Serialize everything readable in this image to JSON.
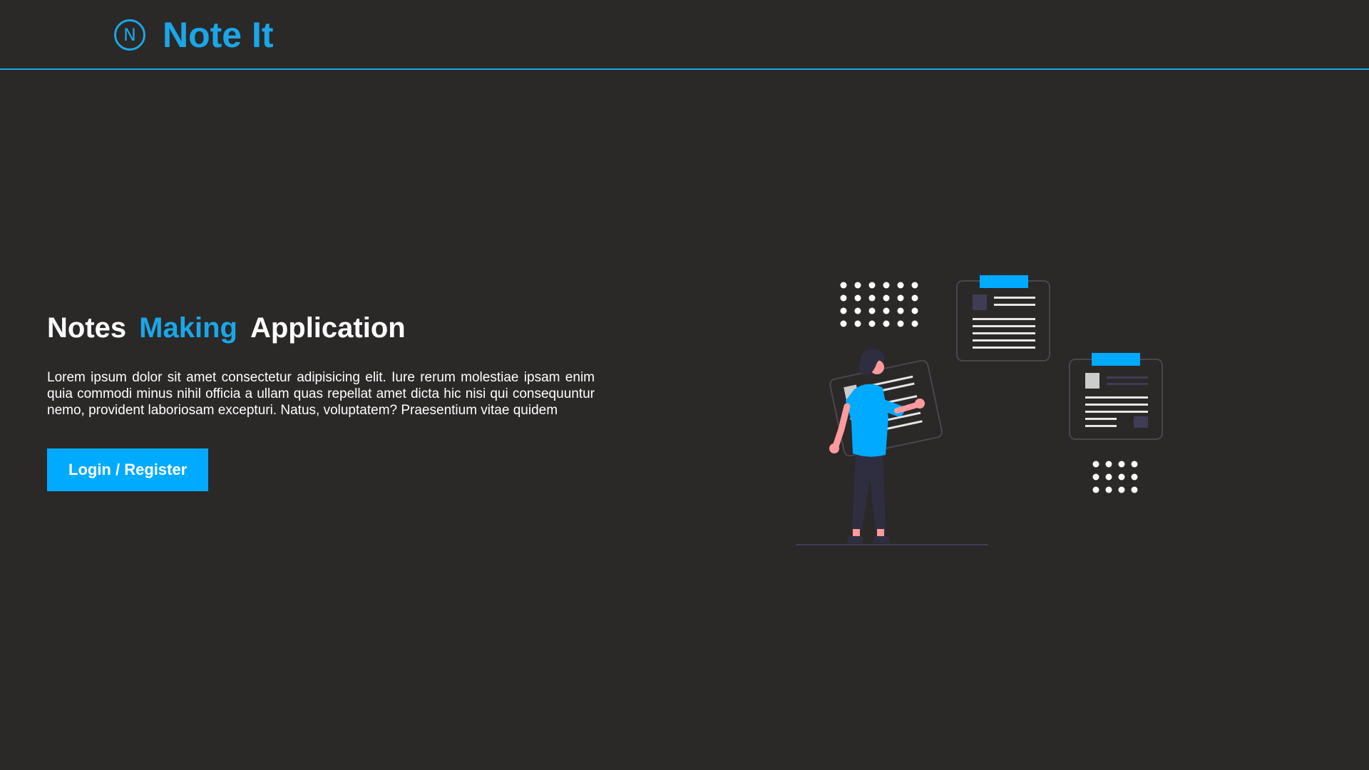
{
  "header": {
    "logo_letter": "N",
    "brand_name": "Note It"
  },
  "hero": {
    "title_word1": "Notes",
    "title_word2": "Making",
    "title_word3": "Application",
    "description": "Lorem ipsum dolor sit amet consectetur adipisicing elit. Iure rerum molestiae ipsam enim quia commodi minus nihil officia a ullam quas repellat amet dicta hic nisi qui consequuntur nemo, provident laboriosam excepturi. Natus, voluptatem? Praesentium vitae quidem",
    "cta_label": "Login / Register"
  },
  "colors": {
    "background": "#2b2828",
    "accent": "#1aa7e8",
    "button": "#00aaff",
    "text": "#ffffff"
  },
  "illustration": {
    "icon": "person-with-notes-illustration"
  }
}
